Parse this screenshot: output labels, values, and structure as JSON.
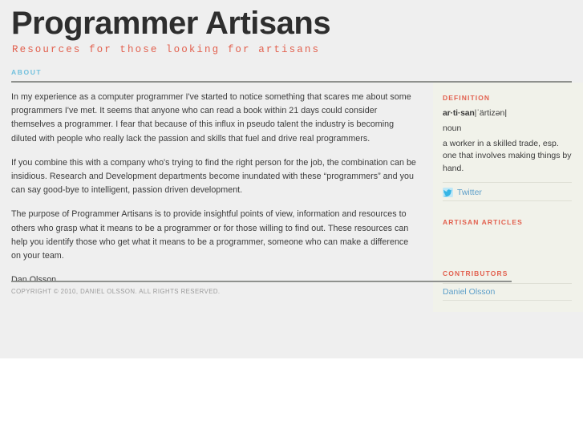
{
  "header": {
    "title": "Programmer Artisans",
    "tagline": "Resources for those looking for artisans"
  },
  "nav": {
    "items": [
      {
        "label": "About",
        "name": "nav-item-about"
      }
    ]
  },
  "main": {
    "paragraphs": [
      "In my experience as a computer programmer I've started to notice something that scares me about some programmers I've met. It seems that anyone who can read a book within 21 days could consider themselves a programmer. I fear that because of this influx in pseudo talent the industry is becoming diluted with people who really lack the passion and skills that fuel and drive real programmers.",
      "If you combine this with a company who's trying to find the right person for the job, the combination can be insidious. Research and Development departments become inundated with these “programmers” and you can say good-bye to intelligent, passion driven development.",
      "The purpose of Programmer Artisans is to provide insightful points of view, information and resources to others who grasp what it means to be a programmer or for those willing to find out. These resources can help you identify those who get what it means to be a programmer, someone who can make a difference on your team."
    ],
    "signature": "Dan Olsson"
  },
  "sidebar": {
    "definition": {
      "title": "Definition",
      "word": "ar·ti·san",
      "pronunciation": "|ˈärtizən|",
      "part_of_speech": "noun",
      "body": "a worker in a skilled trade, esp. one that involves making things by hand."
    },
    "social": {
      "twitter_label": "Twitter",
      "twitter_icon": "twitter-bird-icon"
    },
    "articles": {
      "title": "Artisan Articles",
      "items": []
    },
    "contributors": {
      "title": "Contributors",
      "items": [
        {
          "name": "Daniel Olsson"
        }
      ]
    }
  },
  "footer": {
    "copyright": "Copyright © 2010, Daniel Olsson. All rights reserved."
  },
  "colors": {
    "page_background": "#efefef",
    "accent_red": "#e2604e",
    "accent_blue": "#72c0dd",
    "link_blue": "#5d9fc9",
    "rule_gray": "#8f918e",
    "sidebar_background": "#f1f2ea",
    "text": "#3b3b3b"
  }
}
